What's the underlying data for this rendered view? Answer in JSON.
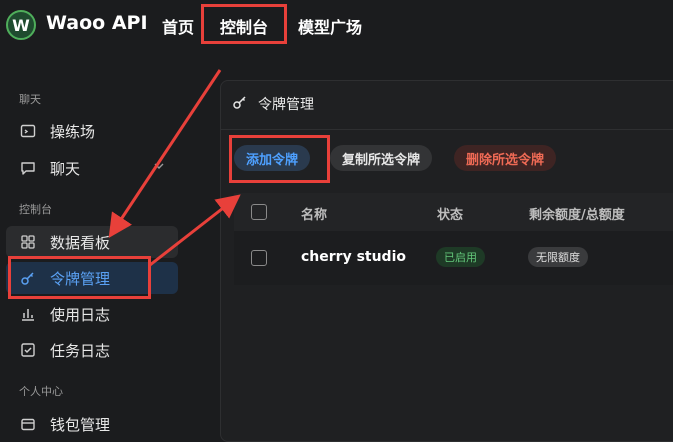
{
  "header": {
    "app_name": "Waoo API",
    "logo_letter": "W",
    "nav": [
      "首页",
      "控制台",
      "模型广场"
    ]
  },
  "sidebar": {
    "sections": [
      {
        "label": "聊天",
        "items": [
          {
            "label": "操练场",
            "icon": "playground-icon"
          },
          {
            "label": "聊天",
            "icon": "chat-icon"
          }
        ]
      },
      {
        "label": "控制台",
        "items": [
          {
            "label": "数据看板",
            "icon": "dashboard-icon"
          },
          {
            "label": "令牌管理",
            "icon": "key-icon",
            "active": true
          },
          {
            "label": "使用日志",
            "icon": "bar-chart-icon"
          },
          {
            "label": "任务日志",
            "icon": "checkbox-icon"
          }
        ]
      },
      {
        "label": "个人中心",
        "items": [
          {
            "label": "钱包管理",
            "icon": "wallet-icon"
          }
        ]
      }
    ]
  },
  "main": {
    "title": "令牌管理",
    "buttons": {
      "add": "添加令牌",
      "copy": "复制所选令牌",
      "delete": "删除所选令牌"
    },
    "table": {
      "headers": [
        "名称",
        "状态",
        "剩余额度/总额度"
      ],
      "rows": [
        {
          "name": "cherry studio",
          "status": "已启用",
          "quota": "无限额度"
        }
      ]
    }
  },
  "colors": {
    "highlight": "#e8403a",
    "accent": "#4ea0ff",
    "danger": "#ef6a55",
    "enabled": "#63c77a"
  }
}
